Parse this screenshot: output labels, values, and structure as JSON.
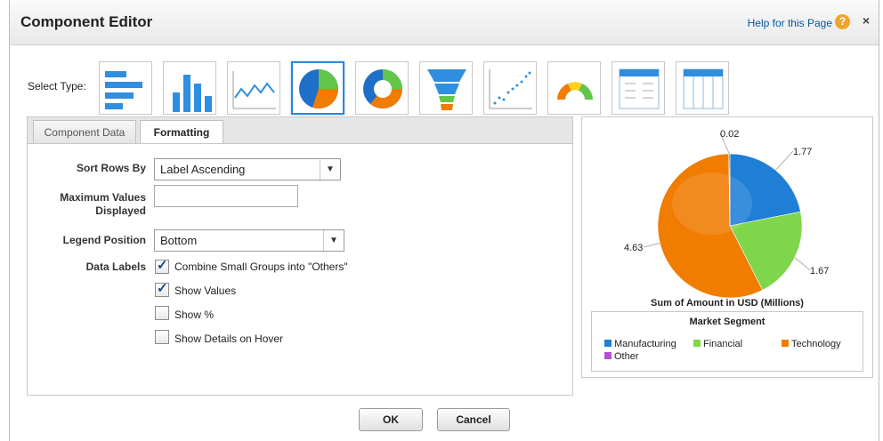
{
  "header": {
    "title": "Component Editor",
    "help_link": "Help for this Page",
    "help_icon": "help-icon",
    "close_glyph": "×"
  },
  "select_type": {
    "label": "Select Type:",
    "types": [
      "horizontal-bar",
      "vertical-bar",
      "line",
      "pie",
      "donut",
      "funnel",
      "scatter",
      "gauge",
      "table",
      "lightning-table"
    ],
    "selected": "pie"
  },
  "tabs": [
    {
      "label": "Component Data",
      "active": false
    },
    {
      "label": "Formatting",
      "active": true
    }
  ],
  "form": {
    "sort_rows_label": "Sort Rows By",
    "sort_rows_value": "Label Ascending",
    "max_values_label": "Maximum Values Displayed",
    "max_values_line1": "Maximum Values",
    "max_values_line2": "Displayed",
    "max_values_value": "",
    "legend_position_label": "Legend Position",
    "legend_position_value": "Bottom",
    "data_labels_label": "Data Labels",
    "checkboxes": [
      {
        "label": "Combine Small Groups into \"Others\"",
        "checked": true
      },
      {
        "label": "Show Values",
        "checked": true
      },
      {
        "label": "Show %",
        "checked": false
      },
      {
        "label": "Show Details on Hover",
        "checked": false
      }
    ]
  },
  "chart_data": {
    "type": "pie",
    "title": "Sum of Amount in USD (Millions)",
    "legend_title": "Market Segment",
    "legend_position": "bottom",
    "series": [
      {
        "name": "Manufacturing",
        "value": 1.77,
        "label": "1.77",
        "color": "#1f7fd7"
      },
      {
        "name": "Financial",
        "value": 1.67,
        "label": "1.67",
        "color": "#7fd64b"
      },
      {
        "name": "Technology",
        "value": 4.63,
        "label": "4.63",
        "color": "#f07c00"
      },
      {
        "name": "Other",
        "value": 0.02,
        "label": "0.02",
        "color": "#b44fd4"
      }
    ]
  },
  "buttons": {
    "ok": "OK",
    "cancel": "Cancel"
  },
  "colors": {
    "accent": "#2f86d6",
    "link": "#015ba7"
  }
}
